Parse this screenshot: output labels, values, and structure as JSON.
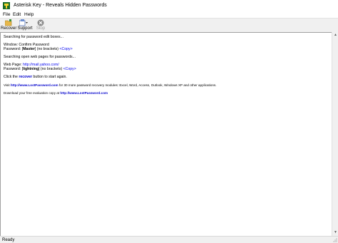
{
  "window": {
    "title": "Asterisk Key - Reveals Hidden Passwords"
  },
  "menu": [
    "File",
    "Edit",
    "Help"
  ],
  "toolbar": {
    "recover_label": "Recover",
    "support_label": "Support",
    "stop_label": "Stop"
  },
  "log": {
    "searching_edit": "Searching for password edit boxes...",
    "window_line": "Window: Confirm Password",
    "pw1_prefix": "Password: [",
    "pw1_value": "Master",
    "pw1_suffix": "] (no brackets) ",
    "copy_label": "<Copy>",
    "searching_web": "Searching open web pages for passwords...",
    "webpage_prefix": "Web Page: ",
    "webpage_url": "http://mail.yahoo.com/",
    "pw2_prefix": "Password: [",
    "pw2_value": "lightning",
    "pw2_suffix": "] (no brackets) ",
    "click_prefix": "Click the ",
    "click_link": "recover",
    "click_suffix": " button to start again.",
    "visit_prefix": "Visit ",
    "visit_link": "http://www.LostPassword.com",
    "visit_suffix": " for 30 more password recovery modules: Excel, Word, Access, Outlook, Windows XP and other applications.",
    "download_prefix": "Download your free evaluation copy at ",
    "download_link": "http://www.LostPassword.com"
  },
  "status": {
    "text": "Ready"
  },
  "colors": {
    "link": "#0000ee",
    "toolbar_bg": "#f0f0f0",
    "stop_icon": "#8a8a8a"
  }
}
